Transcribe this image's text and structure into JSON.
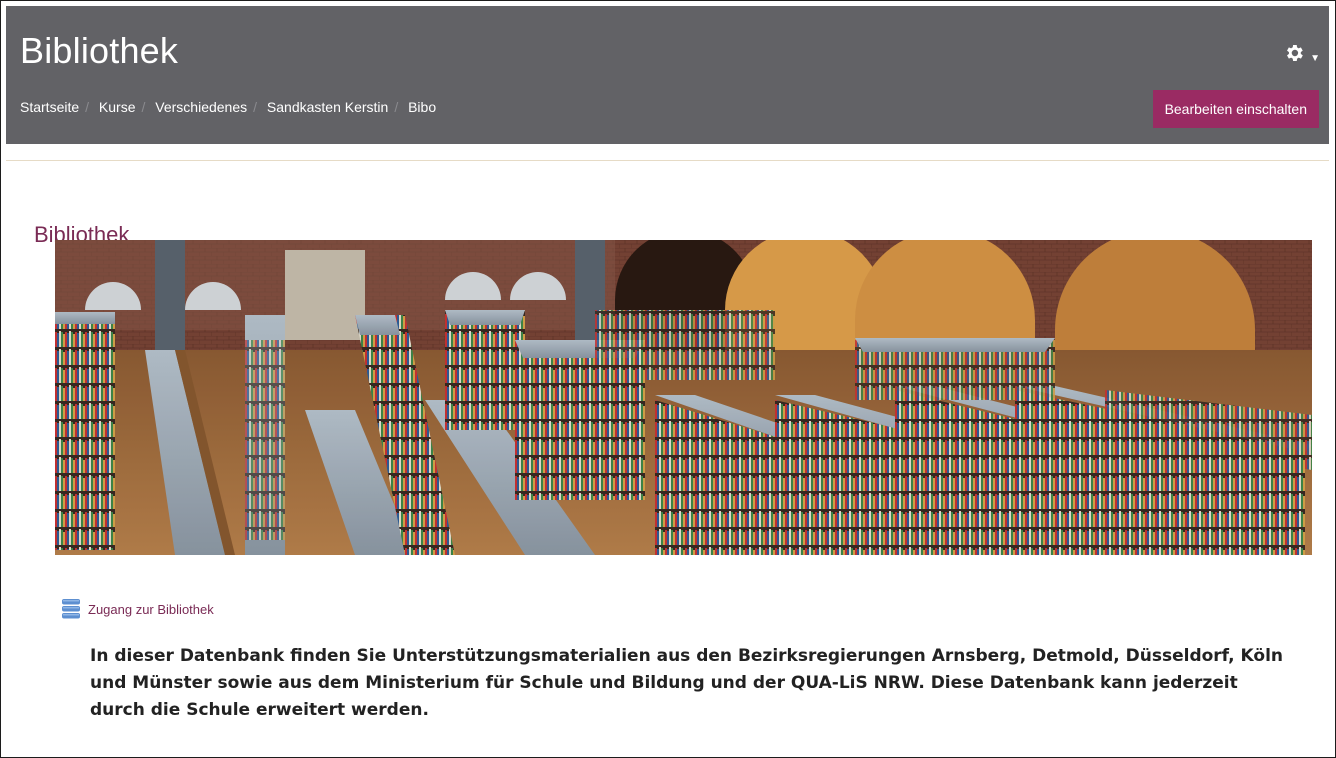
{
  "header": {
    "site_title": "Bibliothek",
    "breadcrumb": [
      {
        "label": "Startseite"
      },
      {
        "label": "Kurse"
      },
      {
        "label": "Verschiedenes"
      },
      {
        "label": "Sandkasten Kerstin"
      },
      {
        "label": "Bibo"
      }
    ],
    "edit_button_label": "Bearbeiten einschalten",
    "settings_icon": "gear-icon",
    "colors": {
      "header_bg": "#626266",
      "accent": "#9a2b63",
      "title_link": "#7a2b55"
    }
  },
  "main": {
    "page_title": "Bibliothek",
    "banner_image": "library-interior-photo",
    "resource": {
      "icon": "database-icon",
      "label": "Zugang zur Bibliothek"
    },
    "description": "In dieser Datenbank finden Sie Unterstützungsmaterialien aus den Bezirksregierungen Arnsberg, Detmold, Düsseldorf, Köln und Münster sowie aus dem Ministerium für Schule und Bildung und der QUA-LiS NRW. Diese Datenbank kann jederzeit durch die Schule erweitert werden."
  }
}
